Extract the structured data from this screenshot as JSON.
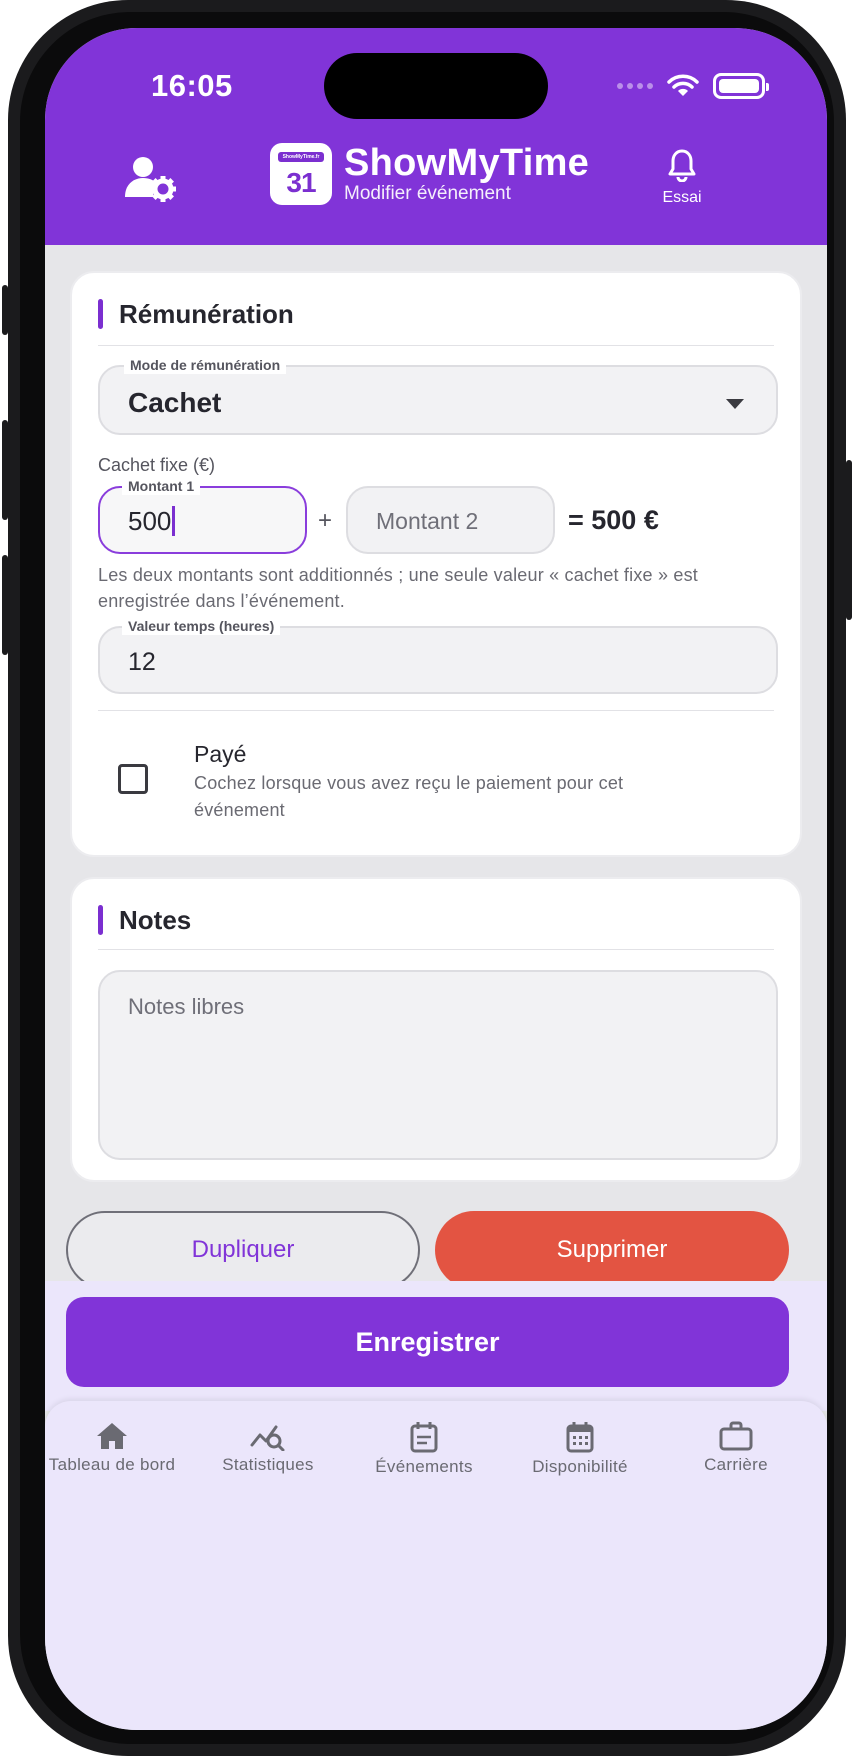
{
  "status_bar": {
    "time": "16:05"
  },
  "header": {
    "title": "ShowMyTime",
    "subtitle": "Modifier événement",
    "logo_number": "31",
    "logo_caption": "ShowMyTime.fr",
    "bell_label": "Essai"
  },
  "remuneration": {
    "title": "Rémunération",
    "mode_label": "Mode de rémunération",
    "mode_value": "Cachet",
    "fixed_label": "Cachet fixe (€)",
    "amount1_label": "Montant 1",
    "amount1_value": "500",
    "plus": "+",
    "amount2_placeholder": "Montant 2",
    "total": "= 500 €",
    "helper": "Les deux montants sont additionnés ; une seule valeur « cachet fixe » est enregistrée dans l’événement.",
    "hours_label": "Valeur temps (heures)",
    "hours_value": "12",
    "paid_title": "Payé",
    "paid_desc": "Cochez lorsque vous avez reçu le paiement pour cet événement"
  },
  "notes": {
    "title": "Notes",
    "placeholder": "Notes libres"
  },
  "actions": {
    "duplicate": "Dupliquer",
    "delete": "Supprimer",
    "save": "Enregistrer"
  },
  "nav": [
    {
      "label": "Tableau de bord",
      "icon": "home-icon"
    },
    {
      "label": "Statistiques",
      "icon": "stats-icon"
    },
    {
      "label": "Événements",
      "icon": "events-icon"
    },
    {
      "label": "Disponibilité",
      "icon": "calendar-icon"
    },
    {
      "label": "Carrière",
      "icon": "briefcase-icon"
    }
  ],
  "colors": {
    "primary": "#8134d8",
    "danger": "#e35442",
    "nav_background": "#ebe6fb"
  }
}
